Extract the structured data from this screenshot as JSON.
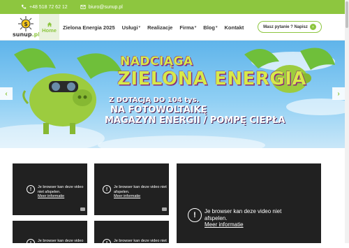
{
  "topbar": {
    "phone": "+48 518 72 62 12",
    "email": "biuro@sunup.pl",
    "color": "#8dc63f"
  },
  "logo": {
    "brand": "sunup",
    "suffix": ".pl"
  },
  "nav": {
    "home": "Home",
    "items": [
      "Zielona Energia 2025",
      "Usługi",
      "Realizacje",
      "Firma",
      "Blog",
      "Kontakt"
    ],
    "cta": "Masz pytanie ? Napisz"
  },
  "banner": {
    "line1": "NADCIĄGA",
    "line2": "ZIELONA ENERGIA",
    "line3": "Z DOTACJĄ DO 104 tys.",
    "line4": "NA FOTOWOLTAIKĘ",
    "line5": "MAGAZYN ENERGII / POMPĘ CIEPŁA"
  },
  "videos": {
    "message": "Je browser kan deze video niet afspelen.",
    "more": "Meer informatie"
  }
}
